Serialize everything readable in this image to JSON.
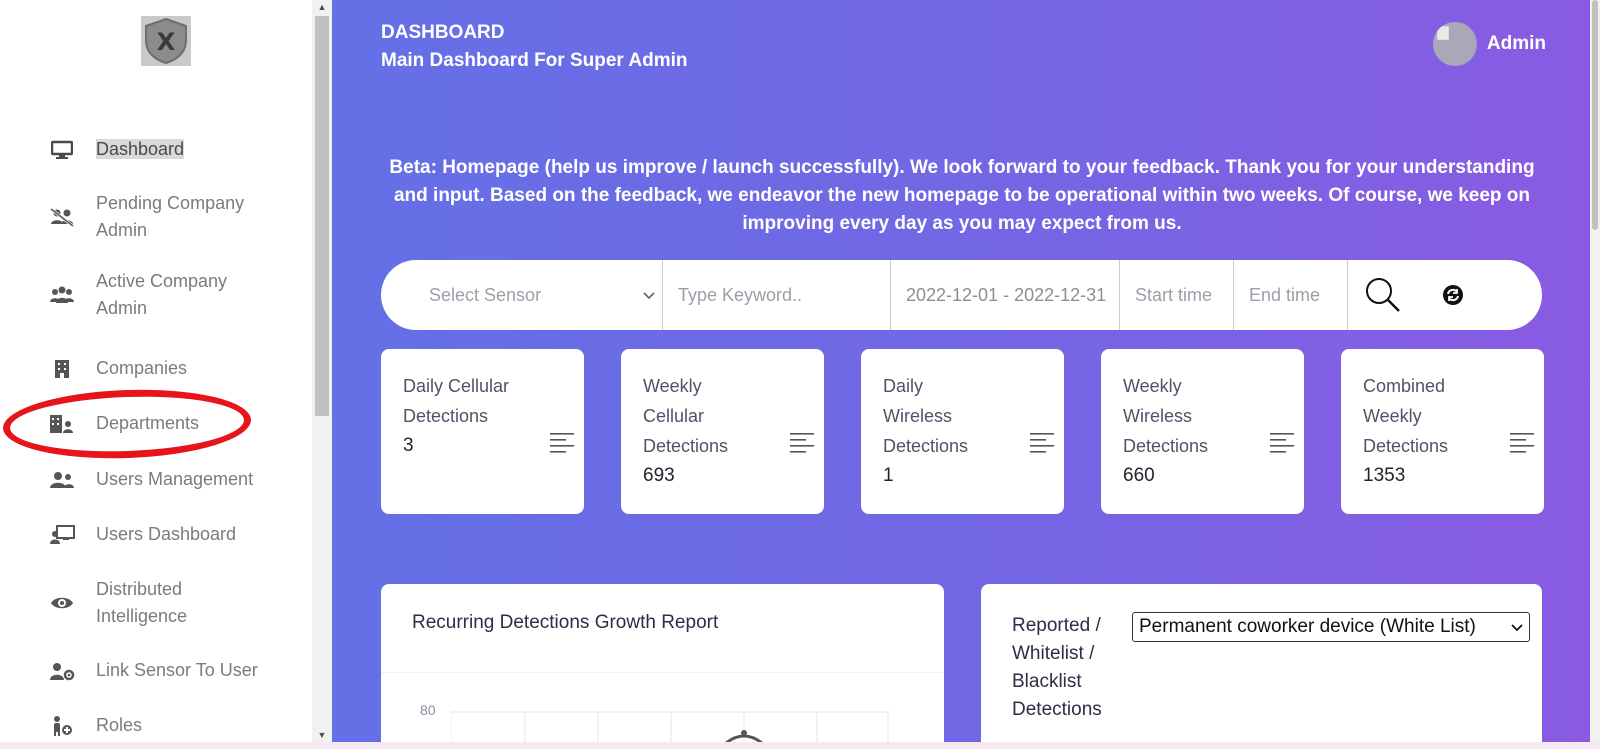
{
  "sidebar": {
    "logo_letter": "X",
    "items": [
      {
        "label": "Dashboard",
        "icon": "monitor-icon"
      },
      {
        "label": "Pending Company Admin",
        "icon": "users-slash-icon"
      },
      {
        "label": "Active Company Admin",
        "icon": "users-icon"
      },
      {
        "label": "Companies",
        "icon": "building-icon"
      },
      {
        "label": "Departments",
        "icon": "building-user-icon"
      },
      {
        "label": "Users Management",
        "icon": "user-group-icon"
      },
      {
        "label": "Users Dashboard",
        "icon": "chalkboard-user-icon"
      },
      {
        "label": "Distributed Intelligence",
        "icon": "eye-icon"
      },
      {
        "label": "Link Sensor To User",
        "icon": "user-gear-icon"
      },
      {
        "label": "Roles",
        "icon": "person-plus-icon"
      }
    ]
  },
  "header": {
    "title": "DASHBOARD",
    "subtitle": "Main Dashboard For Super Admin",
    "user_name": "Admin"
  },
  "beta_message": "Beta: Homepage (help us improve / launch successfully). We look forward to your feedback. Thank you for your understanding and input. Based on the feedback, we endeavor the new homepage to be operational within two weeks. Of course, we keep on improving every day as you may expect from us.",
  "search": {
    "sensor_placeholder": "Select Sensor",
    "keyword_placeholder": "Type Keyword..",
    "date_range": "2022-12-01 - 2022-12-31",
    "start_time_placeholder": "Start time",
    "end_time_placeholder": "End time"
  },
  "stats": [
    {
      "title": "Daily Cellular Detections",
      "value": "3"
    },
    {
      "title": "Weekly Cellular Detections",
      "value": "693"
    },
    {
      "title": "Daily Wireless Detections",
      "value": "1"
    },
    {
      "title": "Weekly Wireless Detections",
      "value": "660"
    },
    {
      "title": "Combined Weekly Detections",
      "value": "1353"
    }
  ],
  "growth_panel": {
    "title": "Recurring Detections Growth Report",
    "y_tick_top": "80"
  },
  "list_panel": {
    "title": "Reported / Whitelist / Blacklist Detections",
    "selected_option": "Permanent coworker device (White List)"
  },
  "colors": {
    "accent_start": "#6470e6",
    "accent_end": "#8a5be2",
    "annotation_red": "#e8141b"
  }
}
